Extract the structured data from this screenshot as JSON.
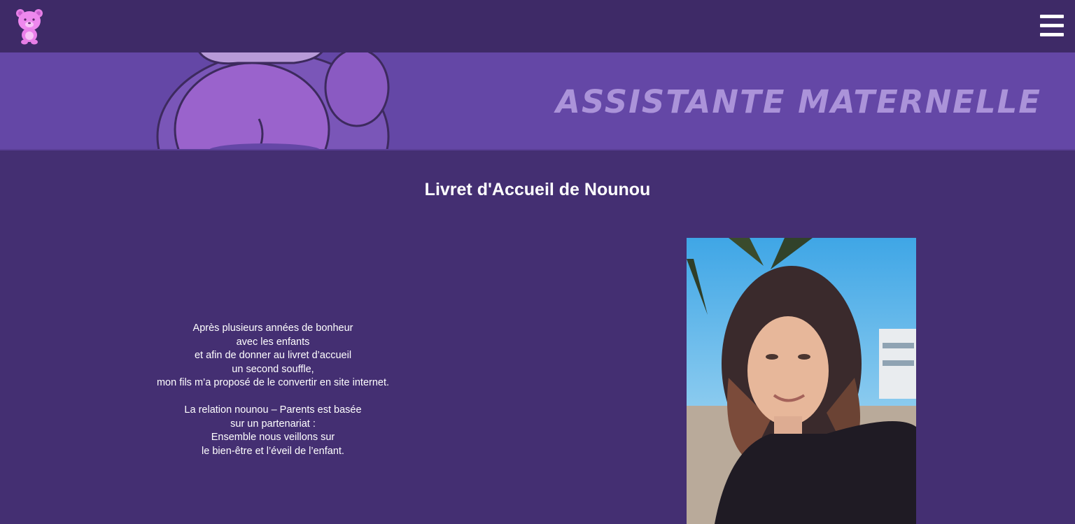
{
  "header": {
    "logo_icon": "teddy-bear-icon",
    "menu_icon": "hamburger-menu-icon"
  },
  "banner": {
    "title": "ASSISTANTE MATERNELLE",
    "decoration": "teddy-bear-illustration"
  },
  "main": {
    "title": "Livret d'Accueil de Nounou",
    "intro_paragraphs": [
      [
        "Après plusieurs années de bonheur",
        "avec les enfants",
        "et afin de donner au livret d’accueil",
        "un second souffle,",
        "mon fils m’a proposé de le convertir en site internet."
      ],
      [
        "La relation nounou – Parents est basée",
        "sur un partenariat :",
        "Ensemble nous veillons sur",
        "le bien-être et l’éveil de l’enfant."
      ]
    ],
    "photo": "portrait-photo"
  },
  "colors": {
    "background": "#442f72",
    "topbar": "#3e2a67",
    "banner": "#6447a6",
    "banner_text": "#b39cdf",
    "text": "#ffffff"
  }
}
